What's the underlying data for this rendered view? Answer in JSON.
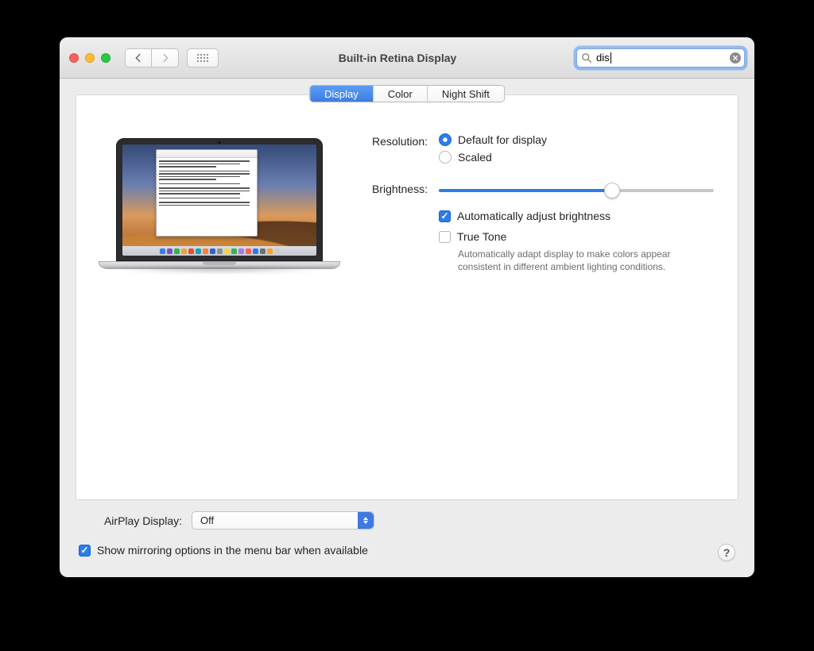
{
  "window": {
    "title": "Built-in Retina Display"
  },
  "search": {
    "value": "dis",
    "placeholder": "Search"
  },
  "tabs": [
    {
      "label": "Display",
      "active": true
    },
    {
      "label": "Color",
      "active": false
    },
    {
      "label": "Night Shift",
      "active": false
    }
  ],
  "resolution": {
    "label": "Resolution:",
    "options": {
      "default": "Default for display",
      "scaled": "Scaled"
    },
    "selected": "default"
  },
  "brightness": {
    "label": "Brightness:",
    "value_percent": 63,
    "auto_label": "Automatically adjust brightness",
    "auto_checked": true
  },
  "truetone": {
    "label": "True Tone",
    "checked": false,
    "description": "Automatically adapt display to make colors appear consistent in different ambient lighting conditions."
  },
  "airplay": {
    "label": "AirPlay Display:",
    "value": "Off"
  },
  "mirroring": {
    "label": "Show mirroring options in the menu bar when available",
    "checked": true
  },
  "help": {
    "label": "?"
  },
  "colors": {
    "accent": "#2b7de9"
  }
}
